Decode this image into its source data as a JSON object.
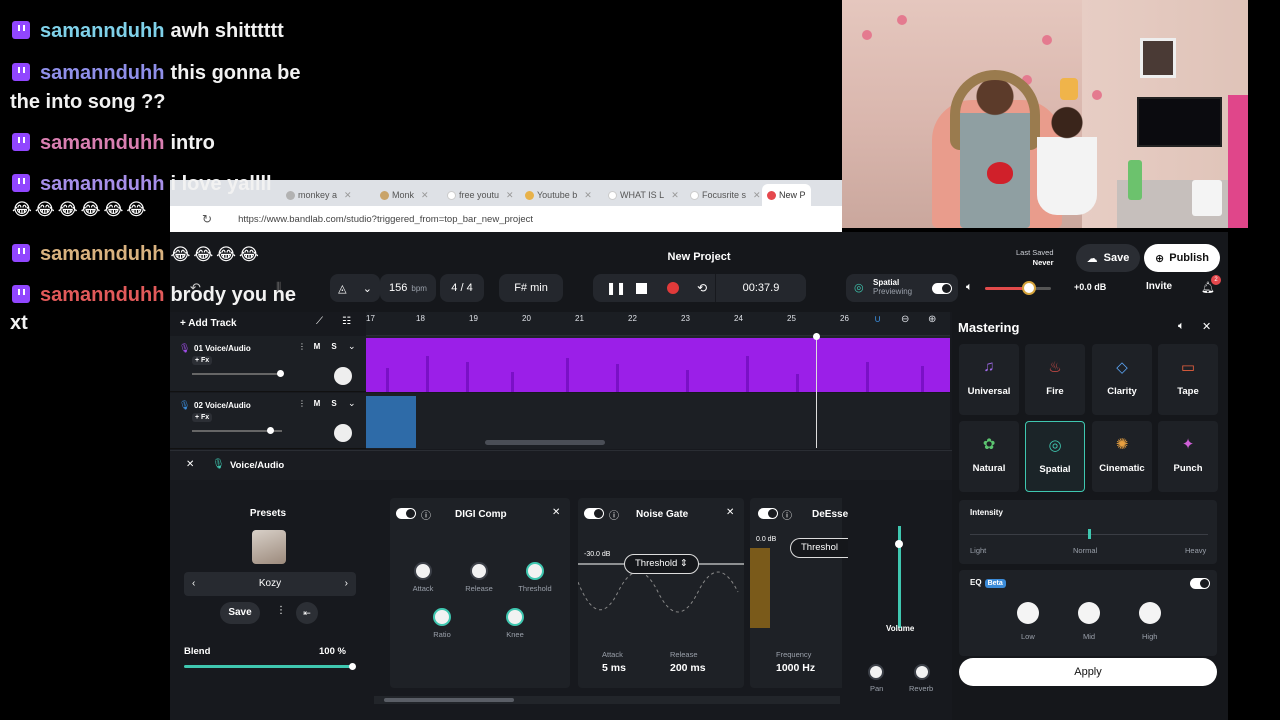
{
  "chat": {
    "messages": [
      {
        "user": "samannduhh",
        "color": "#7fd1e9",
        "text": "awh shitttttt"
      },
      {
        "user": "samannduhh",
        "color": "#8f8fe9",
        "text": "this gonna be",
        "cont": "the into song ??"
      },
      {
        "user": "samannduhh",
        "color": "#d97fb1",
        "text": "intro"
      },
      {
        "user": "samannduhh",
        "color": "#a78fe9",
        "text": "i love yallll",
        "emojis": "😂😂😂😂😂😂"
      },
      {
        "user": "samannduhh",
        "color": "#d9b27f",
        "text": "",
        "emojis": "😂😂😂😂"
      },
      {
        "user": "samannduhh",
        "color": "#e25a5a",
        "text": "brody you ne",
        "cont": "xt"
      }
    ]
  },
  "browser": {
    "tabs": [
      "monkey a",
      "Monk",
      "free youtu",
      "Youtube b",
      "WHAT IS L",
      "Focusrite s",
      "New P"
    ],
    "url": "https://www.bandlab.com/studio?triggered_from=top_bar_new_project"
  },
  "app": {
    "project_title": "New Project",
    "last_saved_label": "Last Saved",
    "last_saved_value": "Never",
    "save": "Save",
    "publish": "Publish",
    "bpm": "156",
    "bpm_unit": "bpm",
    "time_sig": "4 / 4",
    "key": "F# min",
    "time": "00:37.9",
    "spatial_label": "Spatial",
    "spatial_sub": "Previewing",
    "db": "+0.0 dB",
    "invite": "Invite",
    "notif_count": "2",
    "add_track": "Add Track"
  },
  "tracks": [
    {
      "name": "01  Voice/Audio",
      "fx": "+ Fx",
      "mute": "M",
      "solo": "S"
    },
    {
      "name": "02  Voice/Audio",
      "fx": "+ Fx",
      "mute": "M",
      "solo": "S"
    }
  ],
  "ruler": [
    "17",
    "18",
    "19",
    "20",
    "21",
    "22",
    "23",
    "24",
    "25",
    "26"
  ],
  "fx_panel": {
    "track_title": "Voice/Audio",
    "presets_title": "Presets",
    "preset_name": "Kozy",
    "preset_save": "Save",
    "blend_label": "Blend",
    "blend_value": "100 %",
    "digi_comp": {
      "title": "DIGI Comp",
      "attack": "Attack",
      "release": "Release",
      "threshold": "Threshold",
      "ratio": "Ratio",
      "knee": "Knee"
    },
    "noise_gate": {
      "title": "Noise Gate",
      "db": "-30.0 dB",
      "threshold": "Threshold",
      "attack_label": "Attack",
      "attack_value": "5 ms",
      "release_label": "Release",
      "release_value": "200 ms"
    },
    "deesser": {
      "title": "DeEsse",
      "db": "0.0 dB",
      "threshold": "Threshol",
      "freq_label": "Frequency",
      "freq_value": "1000 Hz"
    },
    "volume": "Volume",
    "pan": "Pan",
    "reverb": "Reverb"
  },
  "mastering": {
    "title": "Mastering",
    "presets": [
      {
        "label": "Universal",
        "icon": "♫",
        "color": "#a06ae8"
      },
      {
        "label": "Fire",
        "icon": "♨",
        "color": "#e0504a"
      },
      {
        "label": "Clarity",
        "icon": "◇",
        "color": "#5aa2f0"
      },
      {
        "label": "Tape",
        "icon": "▭",
        "color": "#e8603e"
      },
      {
        "label": "Natural",
        "icon": "✿",
        "color": "#5cc470"
      },
      {
        "label": "Spatial",
        "icon": "◎",
        "color": "#3fc7b0"
      },
      {
        "label": "Cinematic",
        "icon": "✺",
        "color": "#e8a040"
      },
      {
        "label": "Punch",
        "icon": "✦",
        "color": "#d060d8"
      }
    ],
    "intensity_label": "Intensity",
    "intensity_light": "Light",
    "intensity_normal": "Normal",
    "intensity_heavy": "Heavy",
    "eq_label": "EQ",
    "eq_beta": "Beta",
    "eq_low": "Low",
    "eq_mid": "Mid",
    "eq_high": "High",
    "apply": "Apply"
  }
}
